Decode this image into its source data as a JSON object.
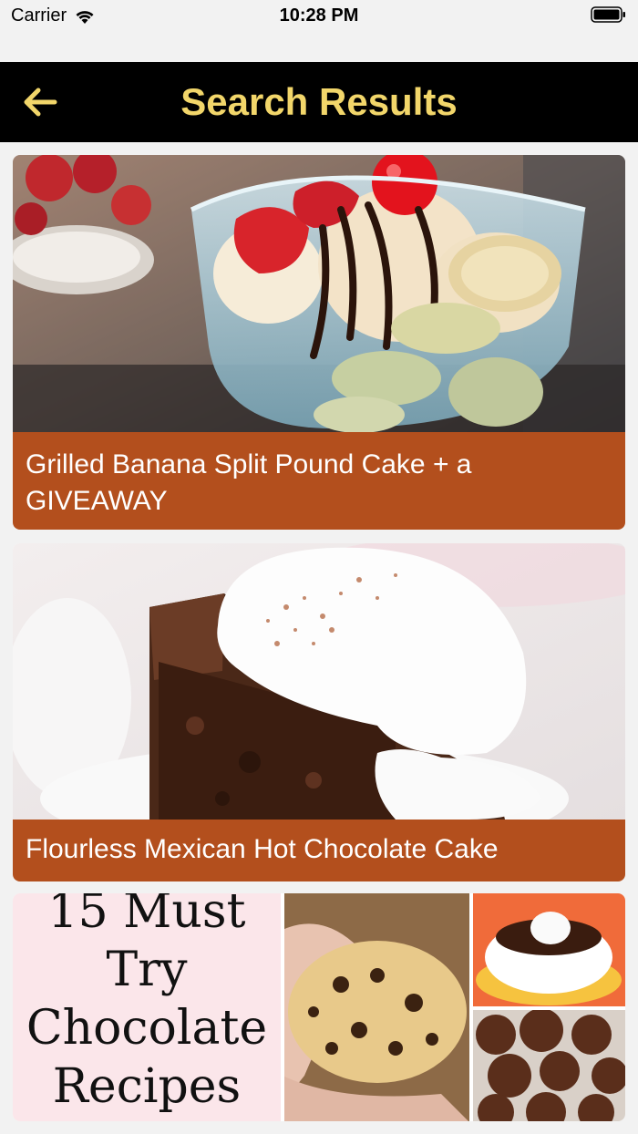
{
  "status_bar": {
    "carrier": "Carrier",
    "time": "10:28 PM"
  },
  "nav": {
    "title": "Search Results",
    "back_icon": "arrow-left-icon",
    "title_color": "#f2d66a",
    "background": "#000000"
  },
  "results": [
    {
      "title": "Grilled Banana Split Pound Cake + a GIVEAWAY",
      "image": "banana-split-sundae-photo"
    },
    {
      "title": "Flourless Mexican Hot Chocolate Cake",
      "image": "chocolate-cake-with-cream-photo"
    },
    {
      "image_text": [
        "15 Must",
        "Try",
        "Chocolate",
        "Recipes"
      ],
      "image": "chocolate-recipes-collage"
    }
  ],
  "colors": {
    "caption_background": "#b34f1d",
    "page_background": "#f2f2f2"
  }
}
